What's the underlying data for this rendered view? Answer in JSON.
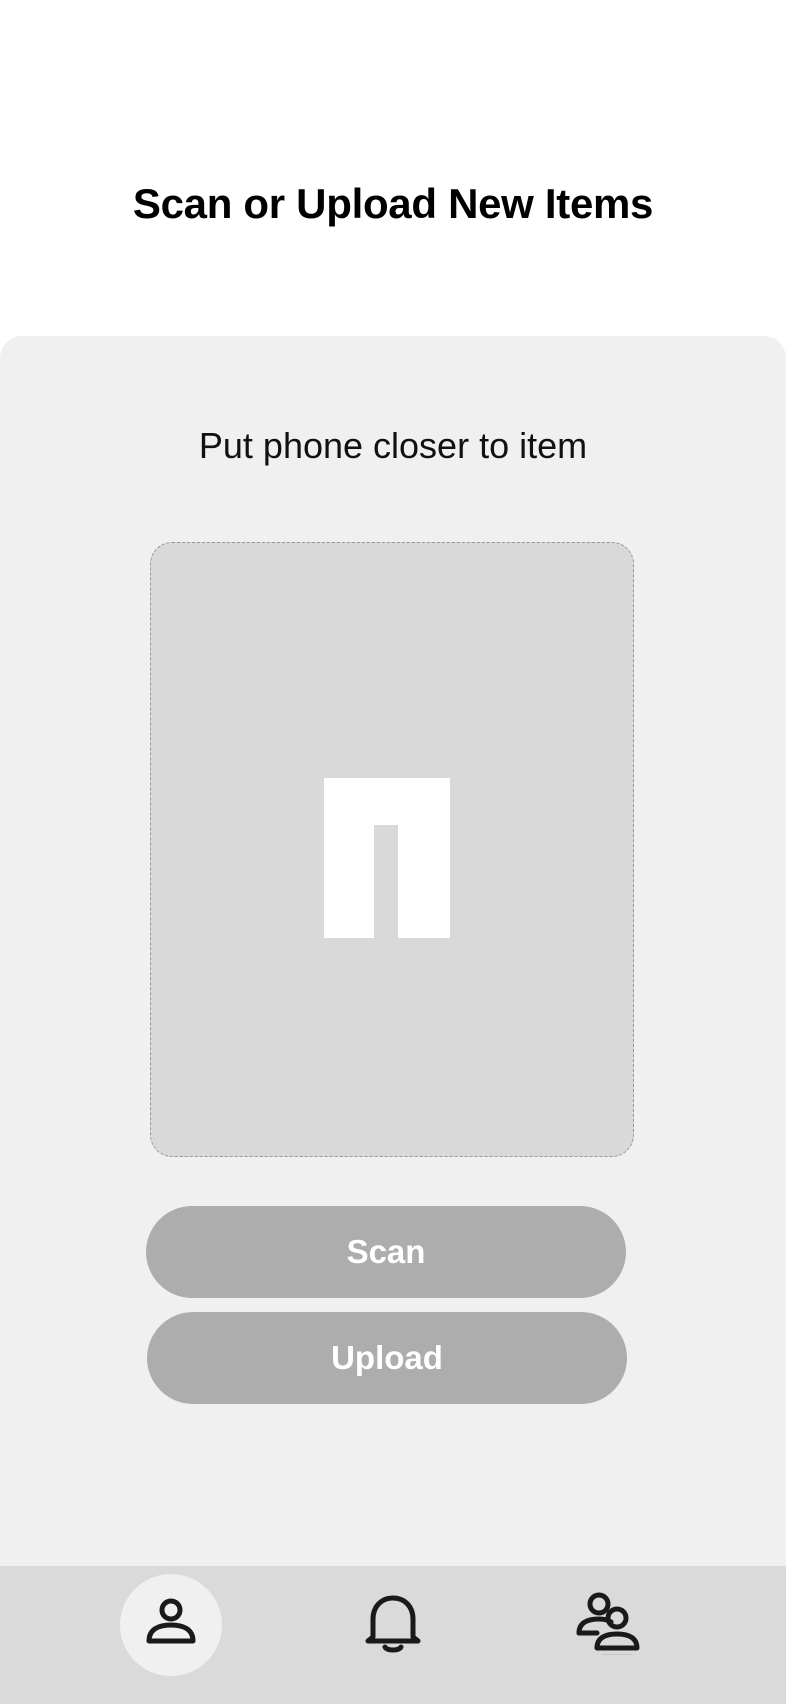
{
  "header": {
    "title": "Scan or Upload New Items"
  },
  "scanner": {
    "hint": "Put phone closer to item",
    "preview_icon": "image-placeholder-icon"
  },
  "actions": {
    "scan_label": "Scan",
    "upload_label": "Upload"
  },
  "bottom_nav": {
    "items": [
      {
        "icon": "user-icon",
        "active": true
      },
      {
        "icon": "bell-icon",
        "active": false
      },
      {
        "icon": "users-icon",
        "active": false
      }
    ]
  },
  "colors": {
    "panel_bg": "#f0f0f0",
    "preview_bg": "#d9d9d9",
    "button_bg": "#adadad",
    "nav_bg": "#dadada",
    "active_nav_bg": "#f0f0f0"
  }
}
